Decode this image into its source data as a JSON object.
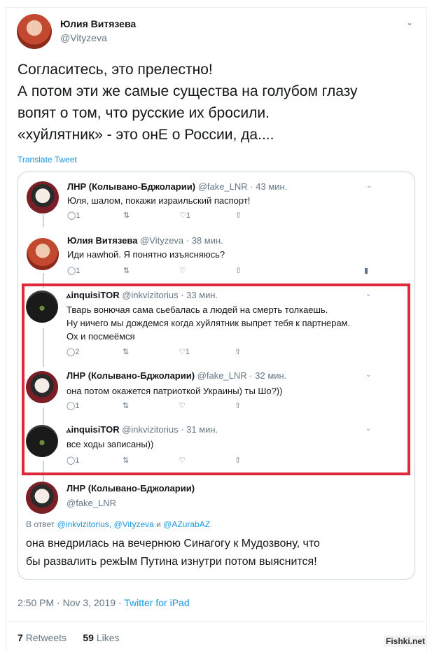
{
  "tweet": {
    "author_name": "Юлия Витязева",
    "author_handle": "@Vityzeva",
    "menu_icon": "chevron-down-icon",
    "text_lines": [
      "Согласитесь, это прелестно!",
      "А потом эти же самые существа на голубом глазу",
      "вопят о том, что русские их бросили.",
      "«хуйлятник» - это онЕ о России, да...."
    ],
    "translate_label": "Translate Tweet",
    "timestamp": "2:50 PM · Nov 3, 2019 · ",
    "source": "Twitter for iPad",
    "retweets_count": "7",
    "retweets_label": "Retweets",
    "likes_count": "59",
    "likes_label": "Likes"
  },
  "embedded": {
    "replies": [
      {
        "name": "ЛНР (Колывано-Бджоларии)",
        "meta": "@fake_LNR · 43 мин.",
        "lines": [
          "Юля, шалом, покажи израильский паспорт!"
        ],
        "reply_count": "1",
        "like_count": "1"
      },
      {
        "name": "Юлия Витязева",
        "meta": "@Vityzeva · 38 мин.",
        "lines": [
          "Иди наwhoй. Я понятно изъясняюсь?"
        ],
        "reply_count": "1",
        "like_count": ""
      },
      {
        "name": "ⲁinquisiTOR",
        "meta": "@inkvizitorius · 33 мин.",
        "lines": [
          "Тварь вонючая сама сьебалась а людей на смерть толкаешь.",
          "Ну ничего мы дождемся когда хуйлятник выпрет тебя к партнерам.",
          "Ох и посмеёмся"
        ],
        "reply_count": "2",
        "like_count": "1"
      },
      {
        "name": "ЛНР (Колывано-Бджоларии)",
        "meta": "@fake_LNR · 32 мин.",
        "lines": [
          "она потом окажется патриоткой Украины) ты Шо?))"
        ],
        "reply_count": "1",
        "like_count": ""
      },
      {
        "name": "ⲁinquisiTOR",
        "meta": "@inkvizitorius · 31 мин.",
        "lines": [
          "все ходы записаны))"
        ],
        "reply_count": "1",
        "like_count": ""
      }
    ],
    "last": {
      "name": "ЛНР (Колывано-Бджоларии)",
      "handle": "@fake_LNR",
      "in_reply_prefix": "В ответ ",
      "mention1": "@inkvizitorius",
      "sep1": ", ",
      "mention2": "@Vityzeva",
      "sep2": " и ",
      "mention3": "@AZurabAZ",
      "lines": [
        "она внедрилась на вечернюю Синагогу к Мудозвону, что",
        "бы развалить режЫм Путина изнутри потом выяснится!"
      ]
    }
  },
  "watermark": "Fishki.net",
  "colors": {
    "accent": "#1b95e0",
    "highlight_border": "#e0283d",
    "muted": "#657786"
  }
}
